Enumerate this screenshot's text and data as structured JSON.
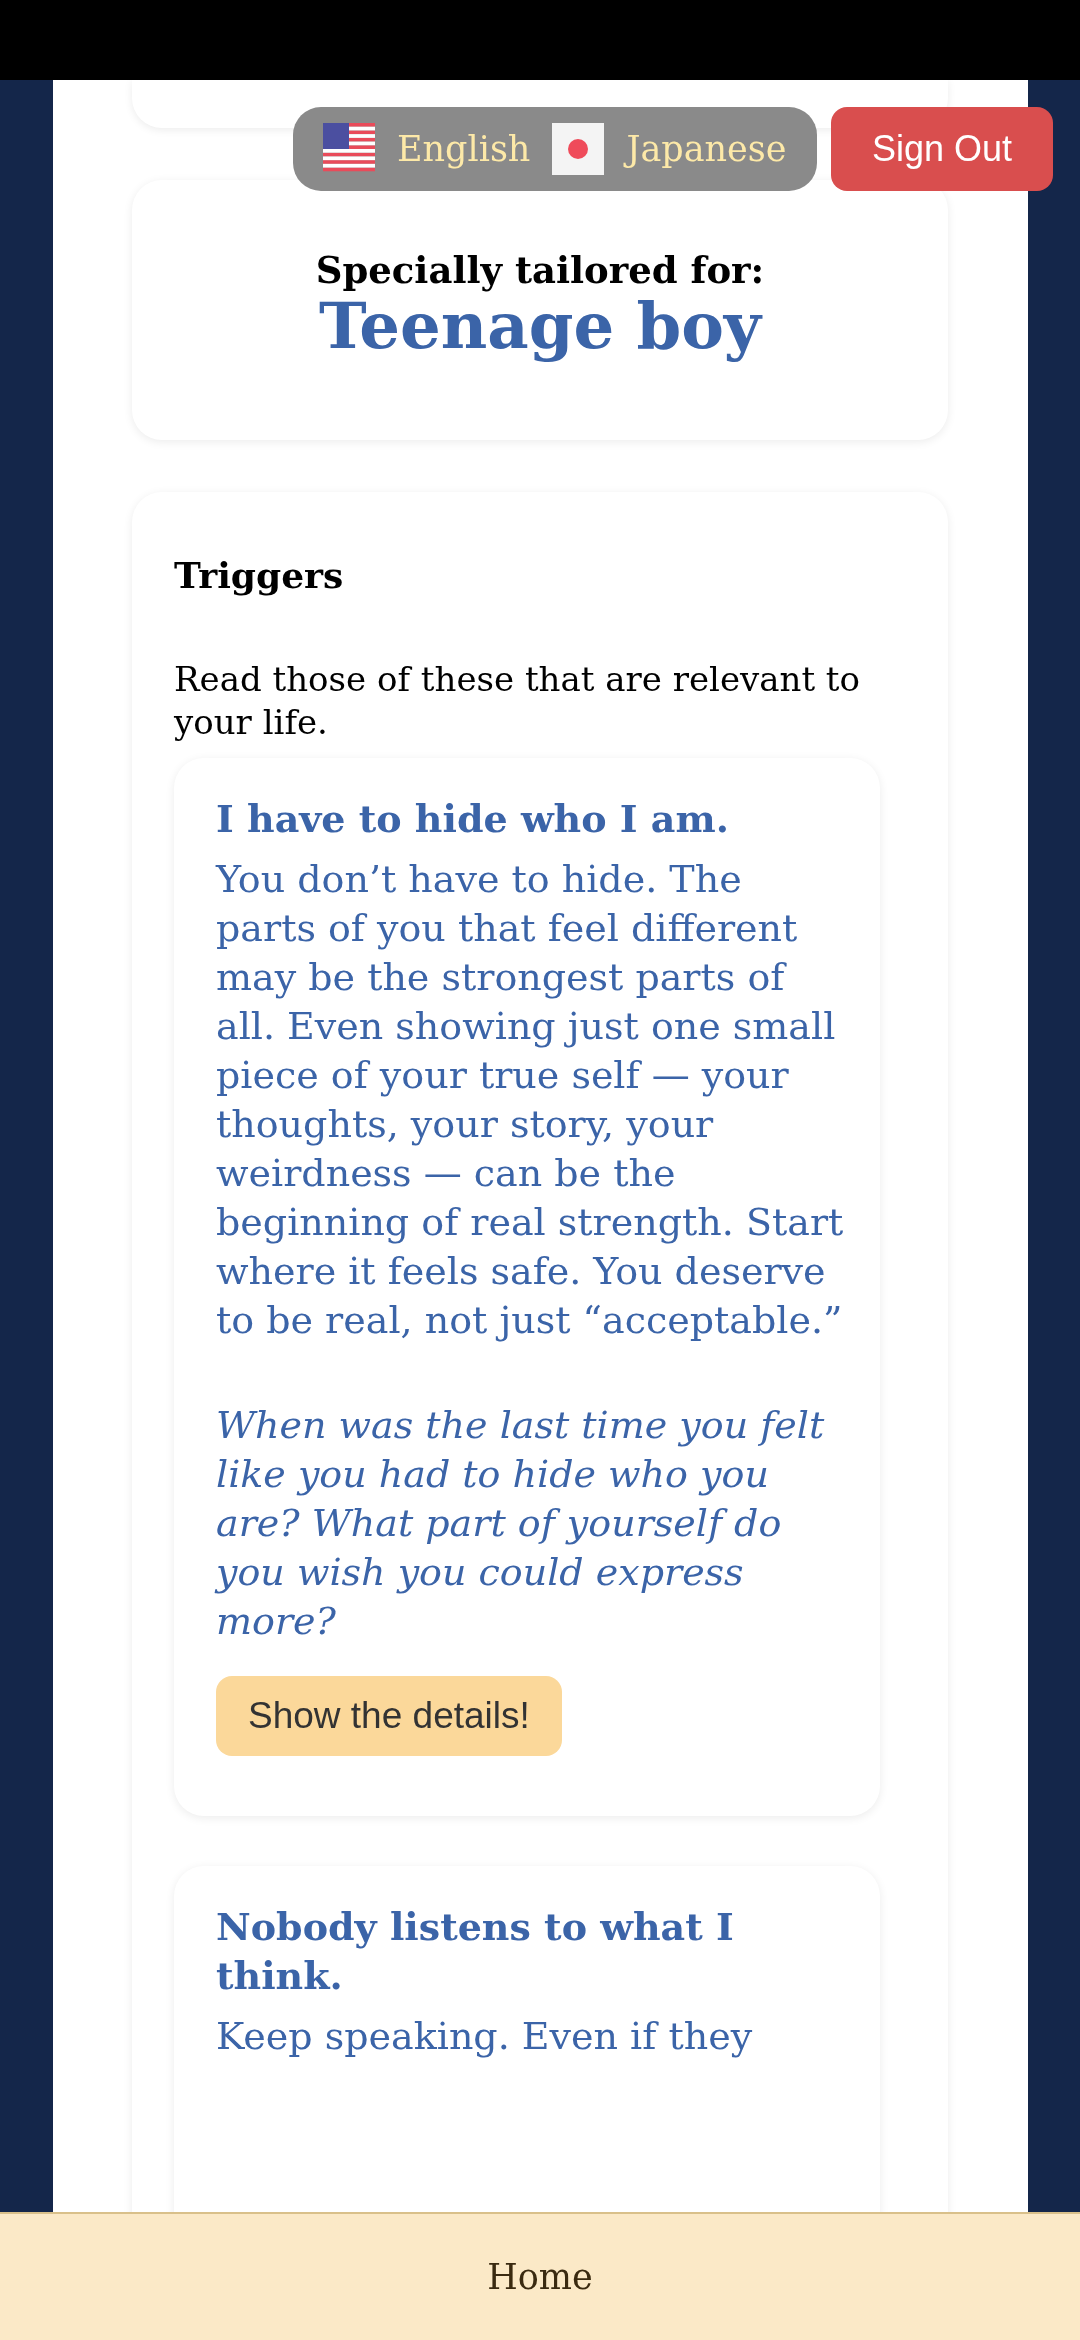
{
  "language_switcher": {
    "options": [
      {
        "kind": "us",
        "label": "English"
      },
      {
        "kind": "jp",
        "label": "Japanese"
      }
    ]
  },
  "sign_out_button": {
    "label": "Sign Out"
  },
  "audience": {
    "heading": "Specially tailored for:",
    "value": "Teenage boy"
  },
  "triggers": {
    "title": "Triggers",
    "intro": "Read those of these that are relevant to your life.",
    "items": [
      {
        "title": "I have to hide who I am.",
        "body": "You don’t have to hide. The parts of you that feel different may be the strongest parts of all. Even showing just one small piece of your true self — your thoughts, your story, your weirdness — can be the beginning of real strength. Start where it feels safe. You deserve to be real, not just “acceptable.”",
        "question": "When was the last time you felt like you had to hide who you are? What part of yourself do you wish you could express more?",
        "button": "Show the details!"
      },
      {
        "title": "Nobody listens to what I think.",
        "body": "Keep speaking. Even if they"
      }
    ]
  },
  "home_bar": {
    "label": "Home"
  }
}
